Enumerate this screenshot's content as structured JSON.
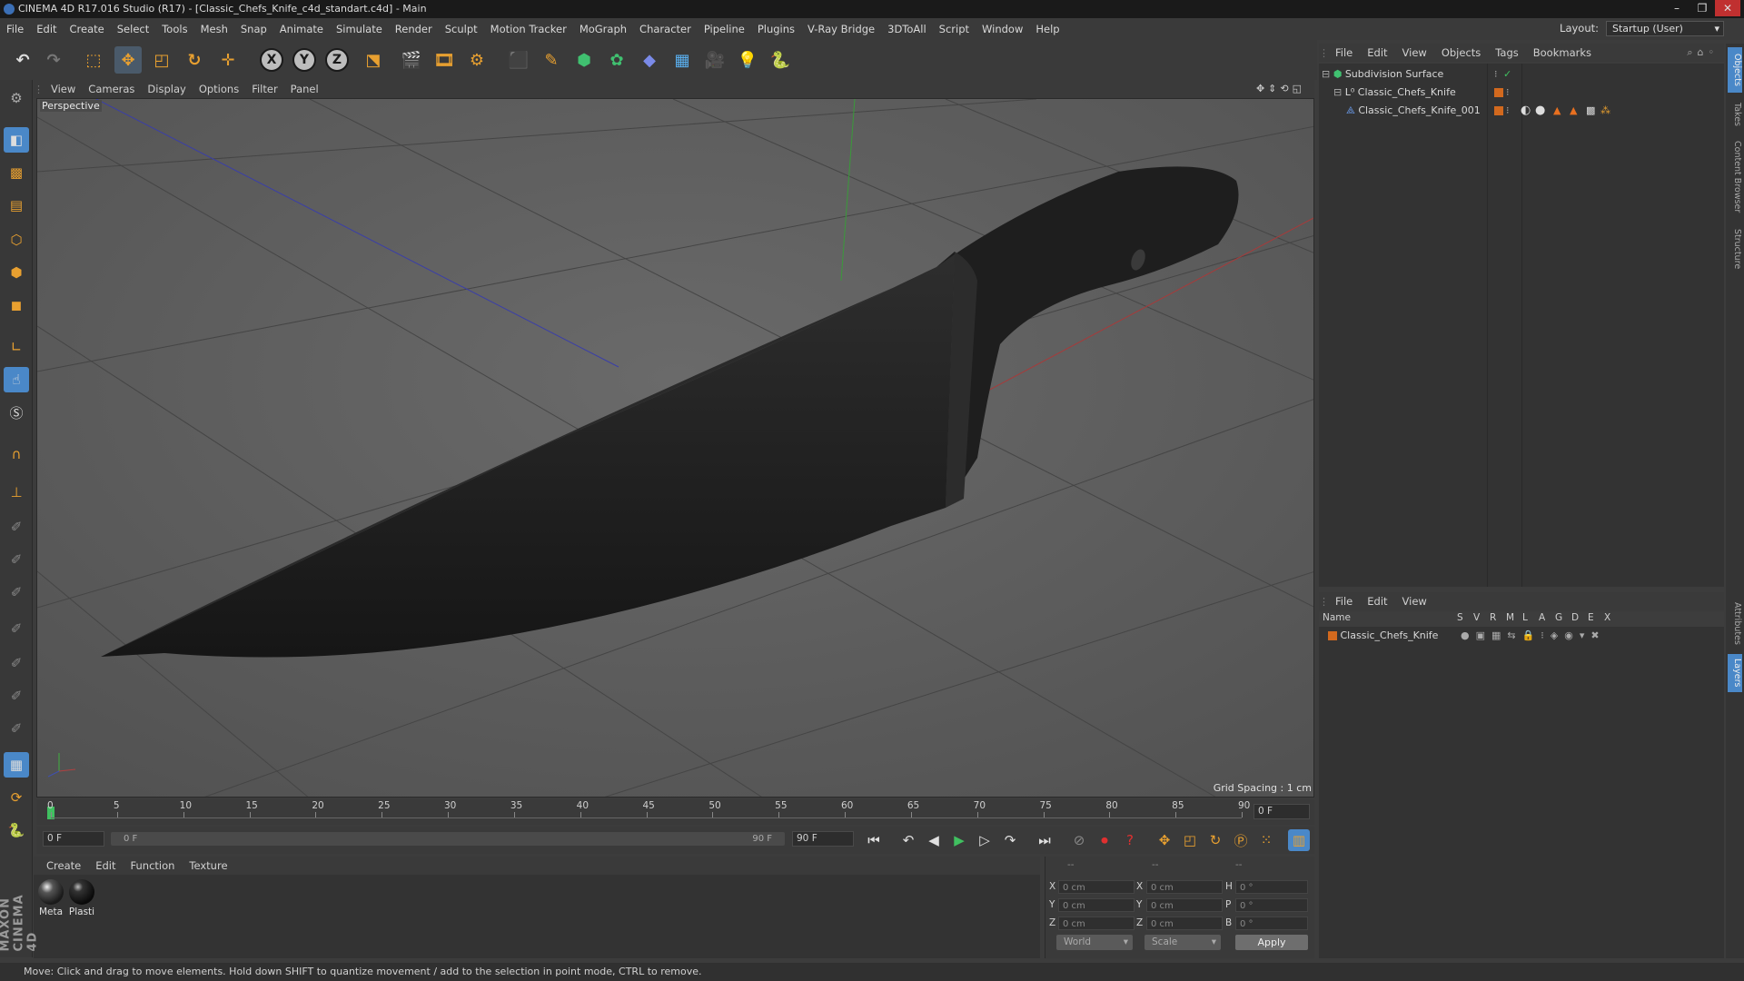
{
  "window": {
    "title": "CINEMA 4D R17.016 Studio (R17) - [Classic_Chefs_Knife_c4d_standart.c4d] - Main",
    "controls": [
      "–",
      "❐",
      "✕"
    ]
  },
  "menu": {
    "items": [
      "File",
      "Edit",
      "Create",
      "Select",
      "Tools",
      "Mesh",
      "Snap",
      "Animate",
      "Simulate",
      "Render",
      "Sculpt",
      "Motion Tracker",
      "MoGraph",
      "Character",
      "Pipeline",
      "Plugins",
      "V-Ray Bridge",
      "3DToAll",
      "Script",
      "Window",
      "Help"
    ],
    "layout_label": "Layout:",
    "layout_value": "Startup (User)"
  },
  "toolbar": {
    "axis_x": "X",
    "axis_y": "Y",
    "axis_z": "Z"
  },
  "viewport": {
    "menu": [
      "View",
      "Cameras",
      "Display",
      "Options",
      "Filter",
      "Panel"
    ],
    "label": "Perspective",
    "grid_spacing": "Grid Spacing : 1 cm"
  },
  "timeline": {
    "ticks": [
      "0",
      "5",
      "10",
      "15",
      "20",
      "25",
      "30",
      "35",
      "40",
      "45",
      "50",
      "55",
      "60",
      "65",
      "70",
      "75",
      "80",
      "85",
      "90"
    ],
    "current_frame": "0 F",
    "start_field": "0 F",
    "range_start": "0 F",
    "range_end": "90 F",
    "end_field": "90 F"
  },
  "materials": {
    "menu": [
      "Create",
      "Edit",
      "Function",
      "Texture"
    ],
    "items": [
      {
        "label": "Meta",
        "color": "#2a2a2a"
      },
      {
        "label": "Plasti",
        "color": "#111111"
      }
    ]
  },
  "coords": {
    "headers": [
      "--",
      "--",
      "--"
    ],
    "pos_labels": [
      "X",
      "Y",
      "Z"
    ],
    "size_labels": [
      "X",
      "Y",
      "Z"
    ],
    "rot_labels": [
      "H",
      "P",
      "B"
    ],
    "pos_values": [
      "0 cm",
      "0 cm",
      "0 cm"
    ],
    "size_values": [
      "0 cm",
      "0 cm",
      "0 cm"
    ],
    "rot_values": [
      "0 °",
      "0 °",
      "0 °"
    ],
    "mode_world": "World",
    "mode_scale": "Scale",
    "apply": "Apply"
  },
  "status": "Move: Click and drag to move elements. Hold down SHIFT to quantize movement / add to the selection in point mode, CTRL to remove.",
  "brand": "MAXON CINEMA 4D",
  "objects": {
    "menu": [
      "File",
      "Edit",
      "View",
      "Objects",
      "Tags",
      "Bookmarks"
    ],
    "tree": [
      {
        "name": "Subdivision Surface",
        "level": 0
      },
      {
        "name": "Classic_Chefs_Knife",
        "level": 1
      },
      {
        "name": "Classic_Chefs_Knife_001",
        "level": 2
      }
    ]
  },
  "layers": {
    "menu": [
      "File",
      "Edit",
      "View"
    ],
    "columns": [
      "Name",
      "S",
      "V",
      "R",
      "M",
      "L",
      "A",
      "G",
      "D",
      "E",
      "X"
    ],
    "rows": [
      {
        "name": "Classic_Chefs_Knife",
        "color": "#d2691e"
      }
    ]
  },
  "side_tabs": [
    "Objects",
    "Takes",
    "Content Browser",
    "Structure",
    "Attributes",
    "Layers"
  ],
  "colors": {
    "accent_orange": "#e8a030",
    "tool_blue": "#4a88c8",
    "axis_x": "#b04040",
    "axis_y": "#40b040",
    "axis_z": "#4050b0"
  }
}
